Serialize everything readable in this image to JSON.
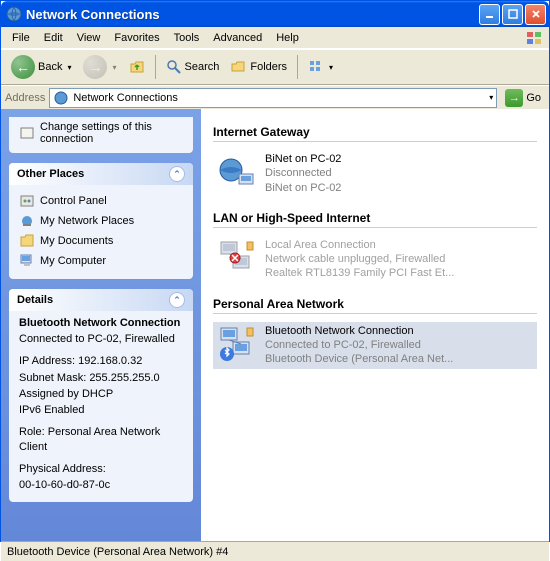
{
  "window": {
    "title": "Network Connections"
  },
  "menu": {
    "file": "File",
    "edit": "Edit",
    "view": "View",
    "favorites": "Favorites",
    "tools": "Tools",
    "advanced": "Advanced",
    "help": "Help"
  },
  "toolbar": {
    "back": "Back",
    "search": "Search",
    "folders": "Folders"
  },
  "address": {
    "label": "Address",
    "value": "Network Connections",
    "go": "Go"
  },
  "left": {
    "top_link": "Change settings of this connection",
    "other_places": {
      "title": "Other Places",
      "items": [
        "Control Panel",
        "My Network Places",
        "My Documents",
        "My Computer"
      ]
    },
    "details": {
      "title": "Details",
      "name": "Bluetooth Network Connection",
      "status": "Connected to PC-02, Firewalled",
      "ip": "IP Address: 192.168.0.32",
      "mask": "Subnet Mask: 255.255.255.0",
      "dhcp": "Assigned by DHCP",
      "ipv6": "IPv6 Enabled",
      "role": "Role: Personal Area Network Client",
      "mac_label": "Physical Address:",
      "mac": "00-10-60-d0-87-0c"
    }
  },
  "groups": {
    "gateway": {
      "title": "Internet Gateway",
      "item": {
        "name": "BiNet on PC-02",
        "status": "Disconnected",
        "device": "BiNet on PC-02"
      }
    },
    "lan": {
      "title": "LAN or High-Speed Internet",
      "item": {
        "name": "Local Area Connection",
        "status": "Network cable unplugged, Firewalled",
        "device": "Realtek RTL8139 Family PCI Fast Et..."
      }
    },
    "pan": {
      "title": "Personal Area Network",
      "item": {
        "name": "Bluetooth Network Connection",
        "status": "Connected to PC-02, Firewalled",
        "device": "Bluetooth Device (Personal Area Net..."
      }
    }
  },
  "statusbar": {
    "text": "Bluetooth Device (Personal Area Network) #4"
  }
}
